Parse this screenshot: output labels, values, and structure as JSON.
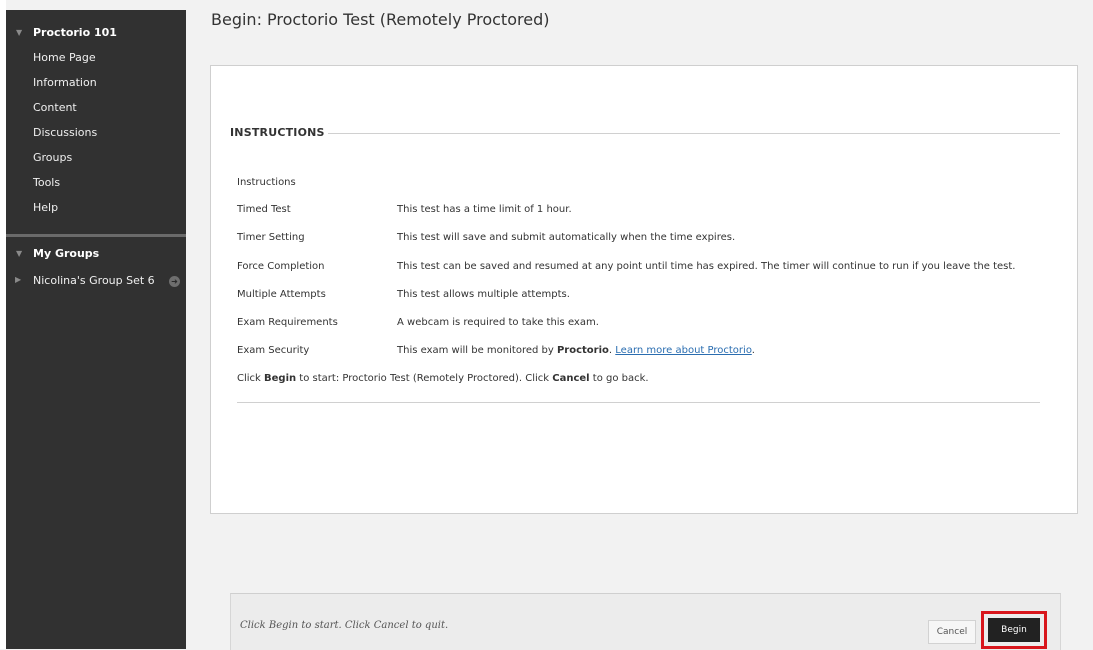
{
  "sidebar": {
    "course": {
      "title": "Proctorio 101",
      "expand_icon": "triangle-down"
    },
    "items": [
      {
        "label": "Home Page"
      },
      {
        "label": "Information"
      },
      {
        "label": "Content"
      },
      {
        "label": "Discussions"
      },
      {
        "label": "Groups"
      },
      {
        "label": "Tools"
      },
      {
        "label": "Help"
      }
    ],
    "my_groups": {
      "title": "My Groups",
      "expand_icon": "triangle-down"
    },
    "group": {
      "label": "Nicolina's Group Set 6",
      "expand_icon": "triangle-right",
      "action_icon": "circle-arrow-right"
    }
  },
  "page": {
    "title": "Begin: Proctorio Test (Remotely Proctored)"
  },
  "instructions": {
    "heading": "INSTRUCTIONS",
    "rows": [
      {
        "label": "Instructions",
        "value": ""
      },
      {
        "label": "Timed Test",
        "value": "This test has a time limit of 1 hour."
      },
      {
        "label": "Timer Setting",
        "value": "This test will save and submit automatically when the time expires."
      },
      {
        "label": "Force Completion",
        "value": "This test can be saved and resumed at any point until time has expired. The timer will continue to run if you leave the test."
      },
      {
        "label": "Multiple Attempts",
        "value": "This test allows multiple attempts."
      },
      {
        "label": "Exam Requirements",
        "value": "A webcam is required to take this exam."
      },
      {
        "label": "Exam Security",
        "value_prefix": "This exam will be monitored by ",
        "value_bold": "Proctorio",
        "value_mid": ". ",
        "link": "Learn more about Proctorio",
        "value_suffix": "."
      }
    ],
    "click_line": {
      "p1": "Click ",
      "b1": "Begin",
      "p2": " to start: Proctorio Test (Remotely Proctored). Click ",
      "b2": "Cancel",
      "p3": " to go back."
    }
  },
  "footer": {
    "text": "Click Begin to start. Click Cancel to quit.",
    "cancel_label": "Cancel",
    "begin_label": "Begin",
    "highlight_color": "#d8161c"
  }
}
